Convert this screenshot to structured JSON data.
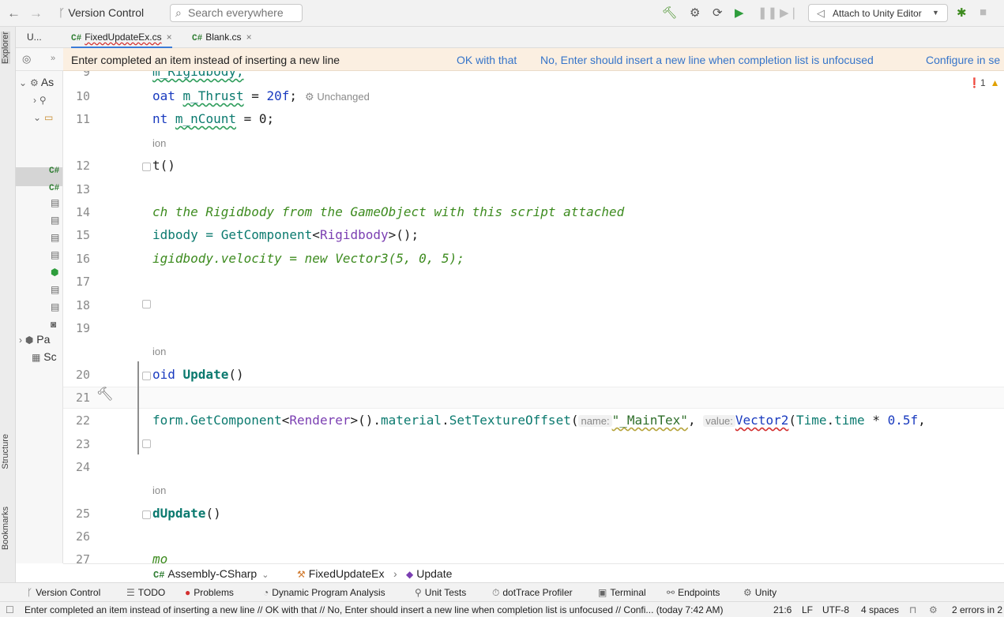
{
  "toolbar": {
    "back_icon": "←",
    "forward_icon": "→",
    "version_control": "Version Control",
    "search_placeholder": "Search everywhere",
    "attach_label": "Attach to Unity Editor"
  },
  "explorer": {
    "tab_label": "U...",
    "rows": [
      "As",
      "Pa",
      "Sc"
    ],
    "strip_tabs": [
      "Explorer",
      "Structure",
      "Bookmarks"
    ]
  },
  "tabs": [
    {
      "label": "FixedUpdateEx.cs",
      "prefix": "C#",
      "close": "×"
    },
    {
      "label": "Blank.cs",
      "prefix": "C#",
      "close": "×"
    }
  ],
  "notification": {
    "message": "Enter completed an item instead of inserting a new line",
    "ok": "OK with that",
    "no": "No, Enter should insert a new line when completion list is unfocused",
    "configure": "Configure in se"
  },
  "editor": {
    "error_count": "1",
    "line_numbers": [
      "9",
      "10",
      "11",
      "12",
      "13",
      "14",
      "15",
      "16",
      "17",
      "18",
      "19",
      "20",
      "21",
      "22",
      "23",
      "24",
      "25",
      "26",
      "27"
    ],
    "hints": [
      "ion",
      "ion",
      "ion"
    ],
    "lines": {
      "l9": "m_Rigidbody;",
      "l10_a": "oat ",
      "l10_field": "m_Thrust",
      "l10_b": " = ",
      "l10_num": "20f",
      "l10_c": ";",
      "l10_unchanged": "Unchanged",
      "l11_a": "nt ",
      "l11_field": "m_nCount",
      "l11_b": " = 0;",
      "l12": "t()",
      "l14": "ch the Rigidbody from the GameObject with this script attached",
      "l15_a": "idbody = ",
      "l15_fn": "GetComponent",
      "l15_b": "<",
      "l15_type": "Rigidbody",
      "l15_c": ">();",
      "l16": "igidbody.velocity = new Vector3(5, 0, 5);",
      "l20_kw": "oid ",
      "l20_fn": "Update",
      "l20_b": "()",
      "l22_a": "form.",
      "l22_fn1": "GetComponent",
      "l22_b": "<",
      "l22_type": "Renderer",
      "l22_c": ">().",
      "l22_fn2": "material",
      "l22_d": ".",
      "l22_fn3": "SetTextureOffset",
      "l22_e": "(",
      "l22_inlay1": "name:",
      "l22_str": "\"_MainTex\"",
      "l22_f": ", ",
      "l22_inlay2": "value:",
      "l22_vec": "Vector2",
      "l22_g": "(",
      "l22_time": "Time",
      "l22_h": ".",
      "l22_time2": "time",
      "l22_i": " * ",
      "l22_num": "0.5f",
      "l22_j": ",",
      "l25_fn": "dUpdate",
      "l25_b": "()",
      "l27": "mo"
    }
  },
  "breadcrumb": [
    "Assembly-CSharp",
    "FixedUpdateEx",
    "Update"
  ],
  "bottom_tools": [
    "Version Control",
    "TODO",
    "Problems",
    "Dynamic Program Analysis",
    "Unit Tests",
    "dotTrace Profiler",
    "Terminal",
    "Endpoints",
    "Unity"
  ],
  "status": {
    "message": "Enter completed an item instead of inserting a new line // OK with that // No, Enter should insert a new line when completion list is unfocused // Confi... (today 7:42 AM)",
    "position": "21:6",
    "line_ending": "LF",
    "encoding": "UTF-8",
    "indent": "4 spaces",
    "errors": "2 errors in 2"
  }
}
